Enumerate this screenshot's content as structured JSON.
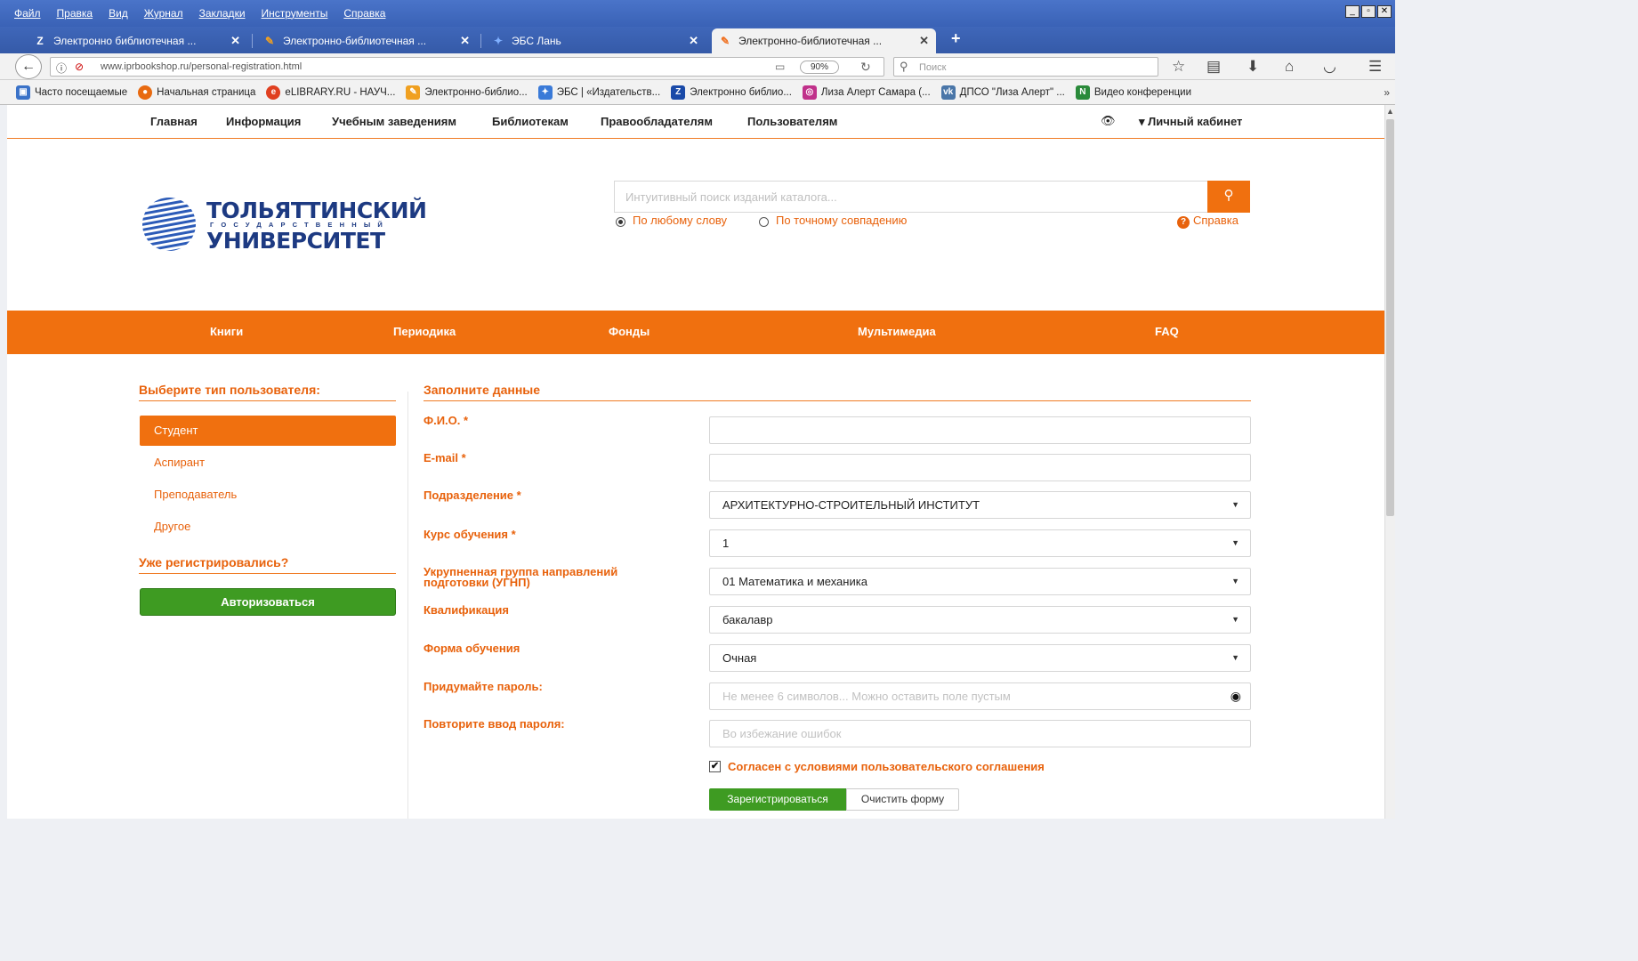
{
  "menu": [
    "Файл",
    "Правка",
    "Вид",
    "Журнал",
    "Закладки",
    "Инструменты",
    "Справка"
  ],
  "window_controls": [
    "_",
    "▫",
    "✕"
  ],
  "tabs": [
    {
      "title": "Электронно библиотечная ...",
      "icon": "Z"
    },
    {
      "title": "Электронно-библиотечная ...",
      "icon": "✎"
    },
    {
      "title": "ЭБС Лань",
      "icon": "✦"
    },
    {
      "title": "Электронно-библиотечная ...",
      "icon": "✎"
    }
  ],
  "new_tab": "+",
  "address": {
    "url": "www.iprbookshop.ru/personal-registration.html",
    "zoom": "90%"
  },
  "browser_search": {
    "placeholder": "Поиск"
  },
  "bookmarks": [
    {
      "label": "Часто посещаемые",
      "color": "#3a72c8"
    },
    {
      "label": "Начальная страница",
      "color": "#e86a10"
    },
    {
      "label": "eLIBRARY.RU - НАУЧ...",
      "color": "#e04020"
    },
    {
      "label": "Электронно-библио...",
      "color": "#f0a020"
    },
    {
      "label": "ЭБС | «Издательств...",
      "color": "#3a7ad8"
    },
    {
      "label": "Электронно библио...",
      "color": "#1a4aa8"
    },
    {
      "label": "Лиза Алерт Самара (...",
      "color": "#c0308a"
    },
    {
      "label": "ДПСО \"Лиза Алерт\" ...",
      "color": "#4a76a8"
    },
    {
      "label": "Видео конференции",
      "color": "#2a8a3a"
    }
  ],
  "bookmarks_more": "»",
  "site_nav": [
    "Главная",
    "Информация",
    "Учебным заведениям",
    "Библиотекам",
    "Правообладателям",
    "Пользователям"
  ],
  "cabinet": "▾ Личный кабинет",
  "logo": {
    "line1": "ТОЛЬЯТТИНСКИЙ",
    "line2": "ГОСУДАРСТВЕННЫЙ",
    "line3": "УНИВЕРСИТЕТ"
  },
  "search": {
    "placeholder": "Интуитивный поиск изданий каталога...",
    "mode_any": "По любому слову",
    "mode_exact": "По точному совпадению",
    "help": "Справка"
  },
  "categories": [
    "Книги",
    "Периодика",
    "Фонды",
    "Мультимедиа",
    "FAQ"
  ],
  "user_types": {
    "title": "Выберите тип пользователя:",
    "items": [
      "Студент",
      "Аспирант",
      "Преподаватель",
      "Другое"
    ],
    "selected": "Студент",
    "already_title": "Уже регистрировались?",
    "auth_button": "Авторизоваться"
  },
  "form": {
    "title": "Заполните данные",
    "fio_label": "Ф.И.О. *",
    "fio_value": "",
    "email_label": "E-mail *",
    "email_value": "",
    "division_label": "Подразделение *",
    "division_value": "АРХИТЕКТУРНО-СТРОИТЕЛЬНЫЙ ИНСТИТУТ",
    "course_label": "Курс обучения *",
    "course_value": "1",
    "ugnp_label_1": "Укрупненная группа направлений",
    "ugnp_label_2": "подготовки (УГНП)",
    "ugnp_value": "01 Математика и механика",
    "qualification_label": "Квалификация",
    "qualification_value": "бакалавр",
    "study_form_label": "Форма обучения",
    "study_form_value": "Очная",
    "password_label": "Придумайте пароль:",
    "password_placeholder": "Не менее 6 символов... Можно оставить поле пустым",
    "password_repeat_label": "Повторите ввод пароля:",
    "password_repeat_placeholder": "Во избежание ошибок",
    "agreement": "Согласен с условиями пользовательского соглашения",
    "agreement_checked": true,
    "register_button": "Зарегистрироваться",
    "clear_button": "Очистить форму"
  },
  "colors": {
    "accent": "#f0700f",
    "link": "#e8620c",
    "success": "#3e9b22",
    "chrome": "#3f67ba"
  }
}
